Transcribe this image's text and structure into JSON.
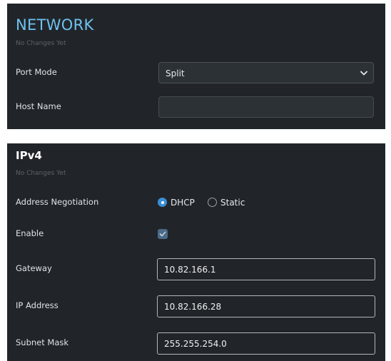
{
  "network": {
    "title": "NETWORK",
    "status": "No Changes Yet",
    "port_mode": {
      "label": "Port Mode",
      "value": "Split"
    },
    "host_name": {
      "label": "Host Name",
      "value": ""
    }
  },
  "ipv4": {
    "title": "IPv4",
    "status": "No Changes Yet",
    "address_negotiation": {
      "label": "Address Negotiation",
      "options": [
        "DHCP",
        "Static"
      ],
      "selected": "DHCP"
    },
    "enable": {
      "label": "Enable",
      "checked": true
    },
    "gateway": {
      "label": "Gateway",
      "value": "10.82.166.1"
    },
    "ip_address": {
      "label": "IP Address",
      "value": "10.82.166.28"
    },
    "subnet_mask": {
      "label": "Subnet Mask",
      "value": "255.255.254.0"
    }
  },
  "colors": {
    "panel_bg": "#212529",
    "accent": "#6ec1f0",
    "radio_selected": "#3a8fd6",
    "checkbox_checked": "#4a6a88"
  },
  "icons": {
    "select_chevron": "chevron-down-icon",
    "checkbox_mark": "check-icon"
  }
}
